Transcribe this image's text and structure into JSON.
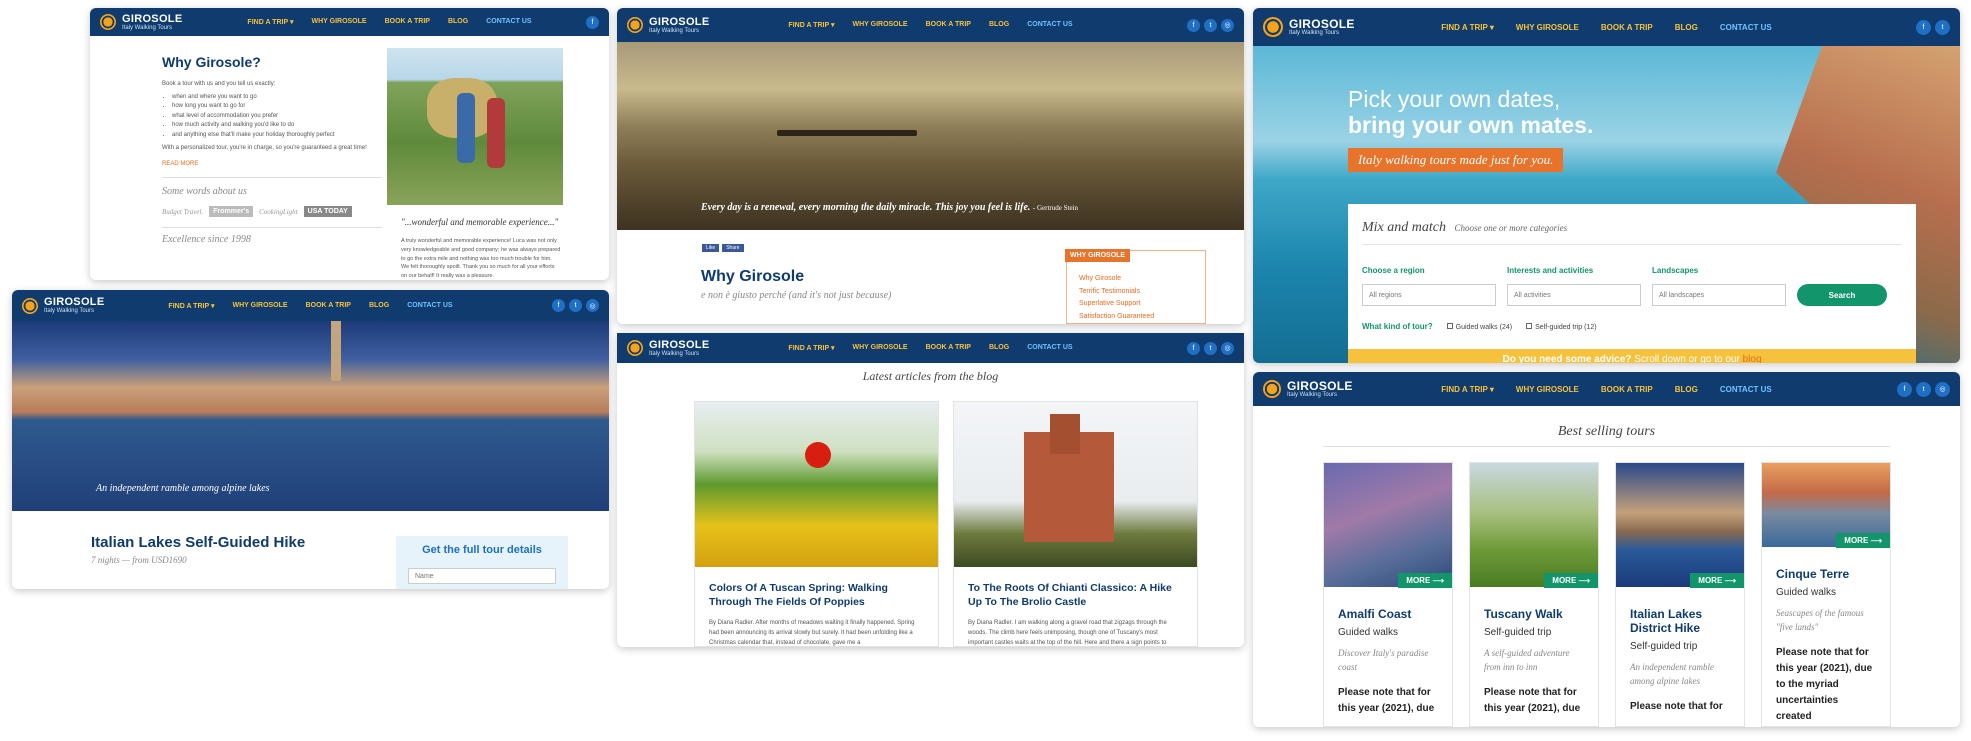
{
  "brand": {
    "name": "GIROSOLE",
    "tagline": "Italy Walking Tours"
  },
  "menu": {
    "find_trip": "FIND A TRIP",
    "why": "WHY GIROSOLE",
    "book": "BOOK A TRIP",
    "blog": "BLOG",
    "contact": "CONTACT US"
  },
  "social": {
    "facebook": "f",
    "twitter": "t",
    "instagram": "◎"
  },
  "panel1": {
    "title": "Why Girosole?",
    "intro": "Book a tour with us and you tell us exactly:",
    "bullets": [
      "when and where you want to go",
      "how long you want to go for",
      "what level of accommodation you prefer",
      "how much activity and walking you'd like to do",
      "and anything else that'll make your holiday thoroughly perfect"
    ],
    "closing": "With a personalized tour, you're in charge, so you're guaranteed a great time!",
    "read_more": "READ MORE",
    "words_title": "Some words about us",
    "press": [
      "Budget Travel.",
      "Frommer's",
      "CookingLight",
      "USA TODAY"
    ],
    "excellence": "Excellence since 1998",
    "quote": "\"...wonderful and memorable experience...\"",
    "quote_text": "A truly wonderful and memorable experience! Luca was not only very knowledgeable and good company; he was always prepared to go the extra mile and nothing was too much trouble for him. We felt thoroughly spoilt. Thank you so much for all your efforts on our behalf! It really was a pleasure."
  },
  "panel2": {
    "hero_caption": "Every day is a renewal, every morning the daily miracle. This joy you feel is life.",
    "hero_author": "- Gertrude Stein",
    "like": "Like",
    "share": "Share",
    "title": "Why Girosole",
    "subtitle": "e non è giusto perché (and it's not just because)",
    "sidebar_title": "WHY GIROSOLE",
    "sidebar_links": [
      "Why Girosole",
      "Terrific Testimonials",
      "Superlative Support",
      "Satisfaction Guaranteed"
    ]
  },
  "panel3": {
    "headline1": "Pick your own dates,",
    "headline2": "bring your own mates.",
    "tag": "Italy walking tours made just for you.",
    "mix_title": "Mix and match",
    "mix_sub": "Choose one or more categories",
    "region_label": "Choose a region",
    "region_value": "All regions",
    "interests_label": "Interests and activities",
    "interests_value": "All activities",
    "land_label": "Landscapes",
    "land_value": "All landscapes",
    "search": "Search",
    "tour_kind": "What kind of tour?",
    "opt1": "Guided walks (24)",
    "opt2": "Self-guided trip (12)",
    "advice": "Do you need some advice?",
    "advice_rest": "Scroll down or go to our",
    "advice_link": "blog"
  },
  "panel4": {
    "hero_caption": "An independent ramble among alpine lakes",
    "title": "Italian Lakes Self-Guided Hike",
    "sub": "7 nights — from USD1690",
    "form_title": "Get the full tour details",
    "name_placeholder": "Name"
  },
  "panel5": {
    "heading": "Latest articles from the blog",
    "articles": [
      {
        "title": "Colors Of A Tuscan Spring: Walking Through The Fields Of Poppies",
        "excerpt": "By Diana Radler. After months of meadows waiting it finally happened. Spring had been announcing its arrival slowly but surely. It had been unfolding like a Christmas calendar that, instead of chocolate, gave me a"
      },
      {
        "title": "To The Roots Of Chianti Classico: A Hike Up To The Brolio Castle",
        "excerpt": "By Diana Radler. I am walking along a gravel road that zigzags through the woods. The climb here feels unimposing, though one of Tuscany's most important castles waits at the top of the hill. Here and there a sign points to"
      }
    ]
  },
  "panel6": {
    "heading": "Best selling tours",
    "more": "MORE",
    "tours": [
      {
        "name": "Amalfi Coast",
        "type": "Guided walks",
        "desc": "Discover Italy's paradise coast",
        "note": "Please note that for this year (2021), due"
      },
      {
        "name": "Tuscany Walk",
        "type": "Self-guided trip",
        "desc": "A self-guided adventure from inn to inn",
        "note": "Please note that for this year (2021), due"
      },
      {
        "name": "Italian Lakes District Hike",
        "type": "Self-guided trip",
        "desc": "An independent ramble among alpine lakes",
        "note": "Please note that for"
      },
      {
        "name": "Cinque Terre",
        "type": "Guided walks",
        "desc": "Seascapes of the famous \"five lands\"",
        "note": "Please note that for this year (2021), due to the myriad uncertainties created"
      }
    ]
  }
}
